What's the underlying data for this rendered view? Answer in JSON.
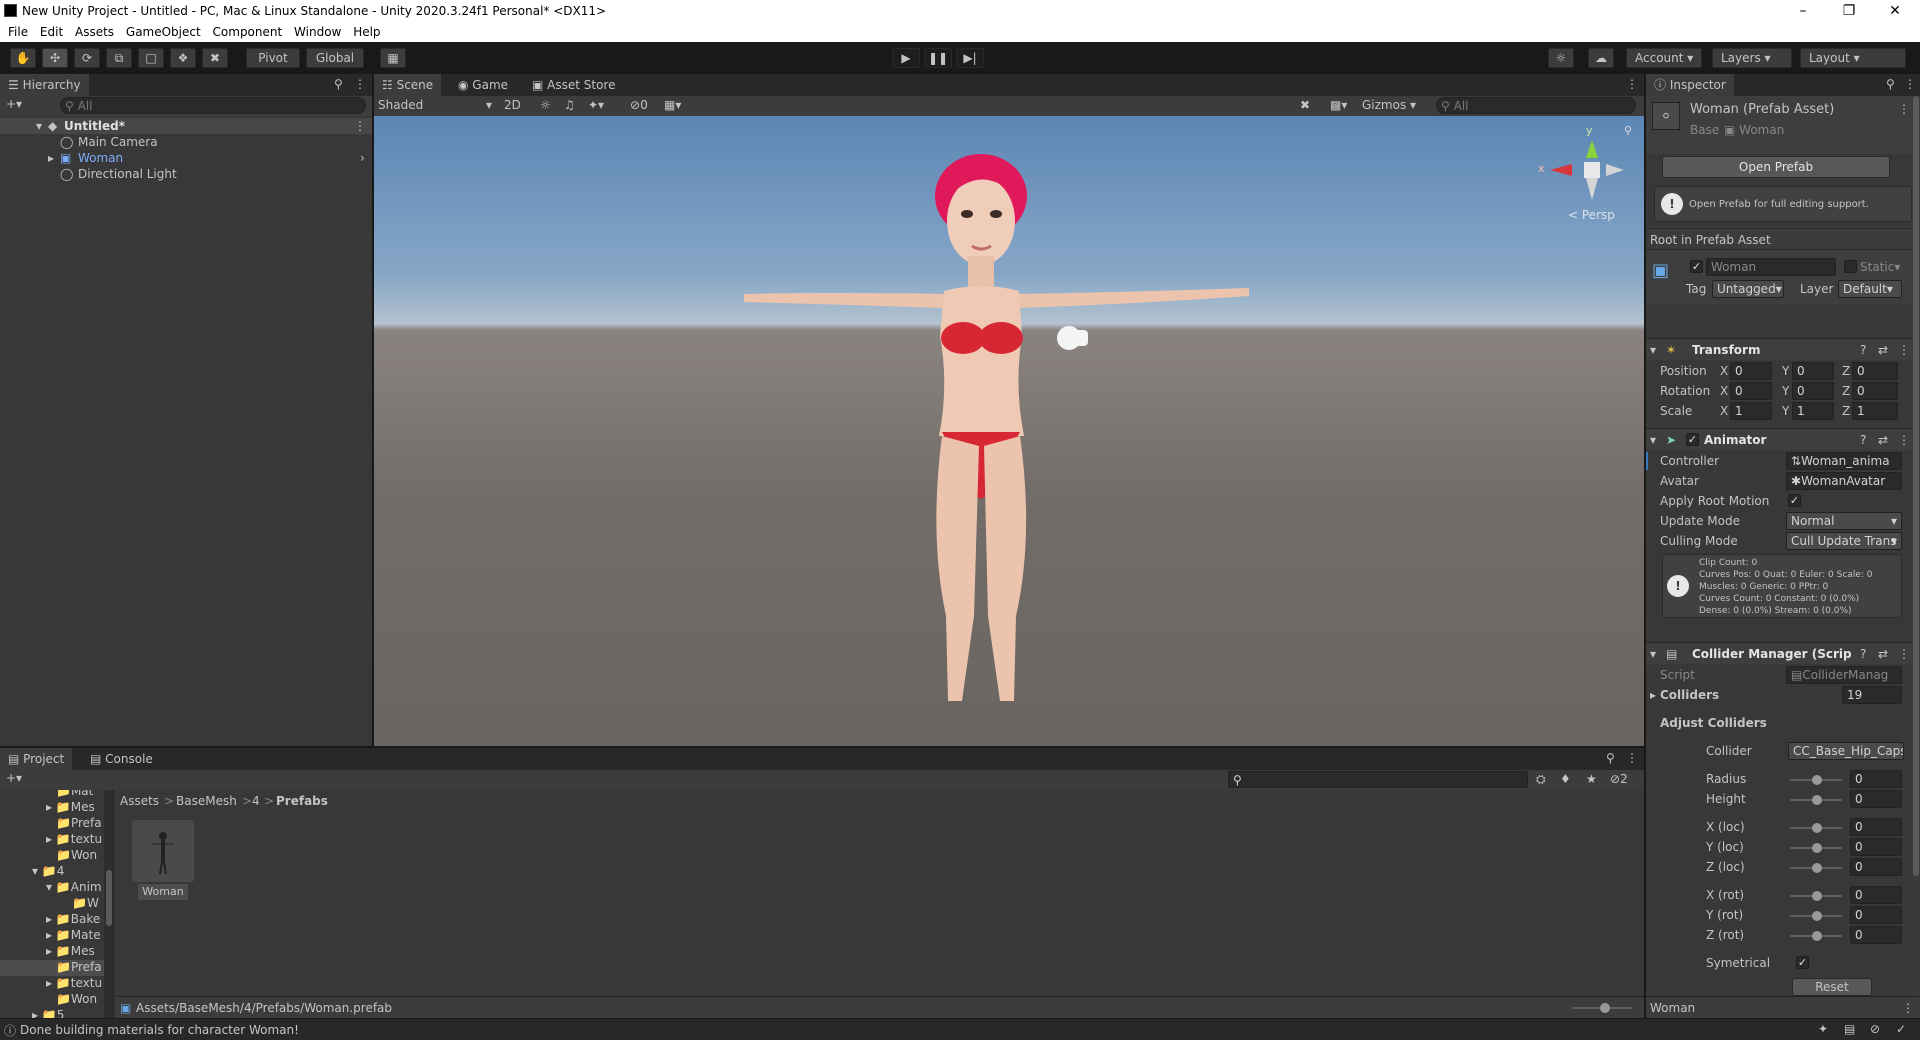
{
  "window": {
    "title": "New Unity Project - Untitled - PC, Mac & Linux Standalone - Unity 2020.3.24f1 Personal* <DX11>"
  },
  "menu": [
    "File",
    "Edit",
    "Assets",
    "GameObject",
    "Component",
    "Window",
    "Help"
  ],
  "toolbar": {
    "pivot": "Pivot",
    "global": "Global",
    "account": "Account",
    "layers": "Layers",
    "layout": "Layout"
  },
  "hierarchy": {
    "tab": "Hierarchy",
    "search_placeholder": "All",
    "scene": "Untitled*",
    "items": [
      "Main Camera",
      "Woman",
      "Directional Light"
    ]
  },
  "scene": {
    "tabs": [
      "Scene",
      "Game",
      "Asset Store"
    ],
    "shading": "Shaded",
    "mode_2d": "2D",
    "hidden_count": "0",
    "gizmos": "Gizmos",
    "search_placeholder": "All",
    "persp": "Persp",
    "axes": {
      "x": "x",
      "y": "y",
      "z": "z"
    }
  },
  "inspector": {
    "tab": "Inspector",
    "title": "Woman (Prefab Asset)",
    "base_label": "Base",
    "base_value": "Woman",
    "open_prefab": "Open Prefab",
    "info": "Open Prefab for full editing support.",
    "root_label": "Root in Prefab Asset",
    "object_name": "Woman",
    "static": "Static",
    "tag_label": "Tag",
    "tag_value": "Untagged",
    "layer_label": "Layer",
    "layer_value": "Default",
    "transform": {
      "title": "Transform",
      "rows": [
        {
          "label": "Position",
          "x": "0",
          "y": "0",
          "z": "0"
        },
        {
          "label": "Rotation",
          "x": "0",
          "y": "0",
          "z": "0"
        },
        {
          "label": "Scale",
          "x": "1",
          "y": "1",
          "z": "1"
        }
      ]
    },
    "animator": {
      "title": "Animator",
      "controller_label": "Controller",
      "controller_value": "Woman_anima",
      "avatar_label": "Avatar",
      "avatar_value": "WomanAvatar",
      "root_motion_label": "Apply Root Motion",
      "update_label": "Update Mode",
      "update_value": "Normal",
      "culling_label": "Culling Mode",
      "culling_value": "Cull Update Trans",
      "stats": [
        "Clip Count: 0",
        "Curves Pos: 0 Quat: 0 Euler: 0 Scale: 0",
        "Muscles: 0 Generic: 0 PPtr: 0",
        "Curves Count: 0 Constant: 0 (0.0%)",
        "Dense: 0 (0.0%) Stream: 0 (0.0%)"
      ]
    },
    "collider_manager": {
      "title": "Collider Manager (Scrip",
      "script_label": "Script",
      "script_value": "ColliderManag",
      "colliders_label": "Colliders",
      "colliders_value": "19",
      "adjust_label": "Adjust Colliders",
      "collider_label": "Collider",
      "collider_value": "CC_Base_Hip_Capsu",
      "sliders": [
        {
          "label": "Radius",
          "value": "0"
        },
        {
          "label": "Height",
          "value": "0"
        },
        {
          "label": "X (loc)",
          "value": "0"
        },
        {
          "label": "Y (loc)",
          "value": "0"
        },
        {
          "label": "Z (loc)",
          "value": "0"
        },
        {
          "label": "X (rot)",
          "value": "0"
        },
        {
          "label": "Y (rot)",
          "value": "0"
        },
        {
          "label": "Z (rot)",
          "value": "0"
        }
      ],
      "symmetrical_label": "Symetrical",
      "reset": "Reset"
    },
    "footer": "Woman"
  },
  "project": {
    "tabs": [
      "Project",
      "Console"
    ],
    "tree": [
      "Mat",
      "Mes",
      "Prefa",
      "textu",
      "Won",
      "4",
      "Anim",
      "W",
      "Bake",
      "Mate",
      "Mes",
      "Prefa",
      "textu",
      "Won",
      "5"
    ],
    "breadcrumb": [
      "Assets",
      "BaseMesh",
      "4",
      "Prefabs"
    ],
    "asset_name": "Woman",
    "path": "Assets/BaseMesh/4/Prefabs/Woman.prefab",
    "hidden_count": "2"
  },
  "status": {
    "text": "Done building materials for character Woman!"
  },
  "colors": {
    "accent": "#3a79bb",
    "bg": "#383838",
    "dark": "#282828",
    "blue_text": "#7cacf8"
  }
}
